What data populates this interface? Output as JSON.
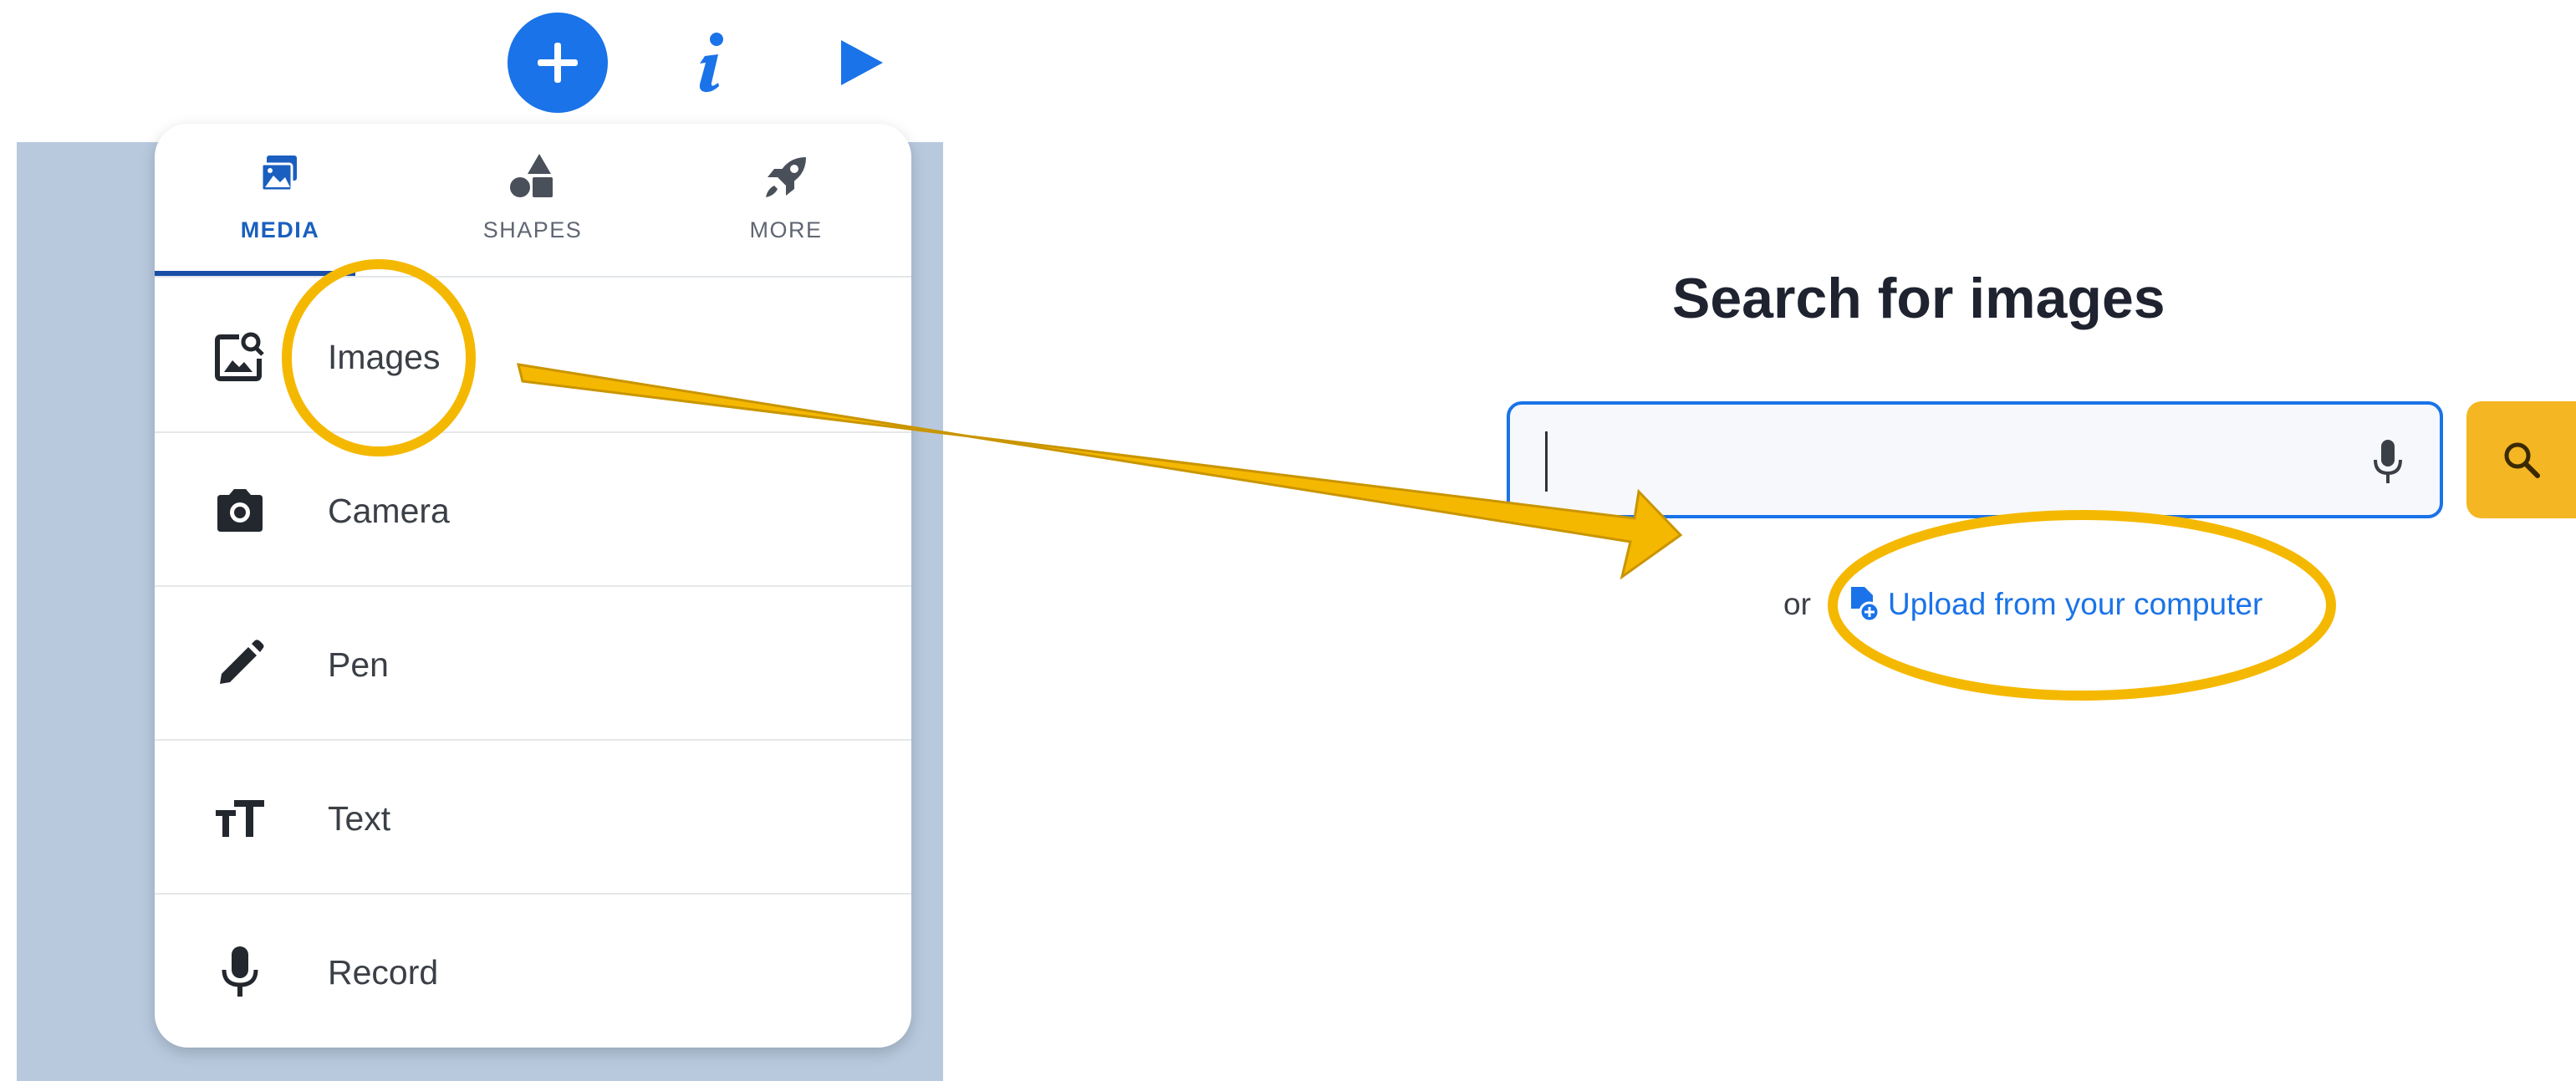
{
  "toolbar": {
    "add_icon": "plus-icon",
    "info_icon": "info-icon",
    "play_icon": "play-icon",
    "accent_color": "#1a73e8"
  },
  "menu": {
    "tabs": [
      {
        "label": "MEDIA",
        "icon": "media-icon",
        "active": true
      },
      {
        "label": "SHAPES",
        "icon": "shapes-icon",
        "active": false
      },
      {
        "label": "MORE",
        "icon": "rocket-icon",
        "active": false
      }
    ],
    "items": [
      {
        "label": "Images",
        "icon": "image-search-icon"
      },
      {
        "label": "Camera",
        "icon": "camera-icon"
      },
      {
        "label": "Pen",
        "icon": "pen-icon"
      },
      {
        "label": "Text",
        "icon": "text-size-icon"
      },
      {
        "label": "Record",
        "icon": "microphone-icon"
      }
    ]
  },
  "search_panel": {
    "title": "Search for images",
    "input_value": "",
    "or_text": "or",
    "upload_label": "Upload from your computer",
    "search_button_color": "#f5b623"
  },
  "annotations": {
    "highlight_color": "#f5b800"
  }
}
